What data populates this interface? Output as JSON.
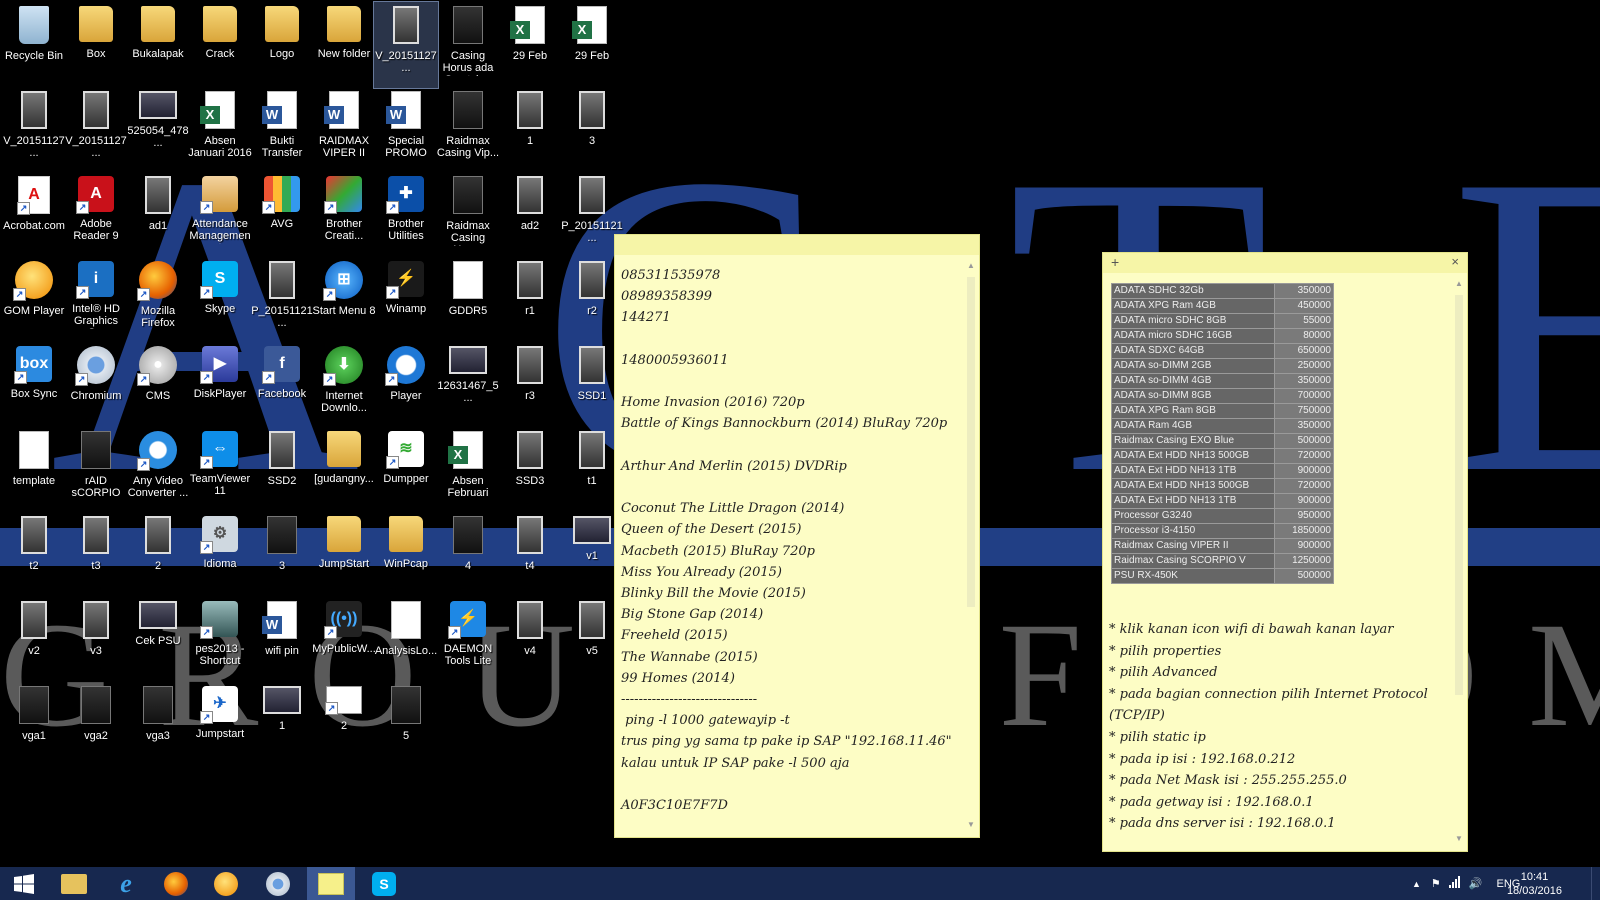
{
  "desktop": {
    "icons": [
      {
        "label": "Recycle Bin",
        "icon": "recycle-bin-icon",
        "type": "recycle"
      },
      {
        "label": "V_20151127...",
        "icon": "video-file-icon",
        "type": "photo"
      },
      {
        "label": "Acrobat.com",
        "icon": "acrobat-icon",
        "type": "acrobat"
      },
      {
        "label": "GOM Player",
        "icon": "gom-player-icon",
        "type": "gom"
      },
      {
        "label": "Box Sync",
        "icon": "box-sync-icon",
        "type": "box"
      },
      {
        "label": "template",
        "icon": "document-icon",
        "type": "doc"
      },
      {
        "label": "t2",
        "icon": "image-icon",
        "type": "photo"
      },
      {
        "label": "v2",
        "icon": "image-icon",
        "type": "photo"
      },
      {
        "label": "vga1",
        "icon": "image-icon",
        "type": "photo-dark"
      },
      {
        "label": "Box",
        "icon": "folder-icon",
        "type": "folder"
      },
      {
        "label": "V_20151127...",
        "icon": "video-file-icon",
        "type": "photo"
      },
      {
        "label": "Adobe Reader 9",
        "icon": "adobe-reader-icon",
        "type": "reader"
      },
      {
        "label": "Intel® HD Graphics C...",
        "icon": "intel-graphics-icon",
        "type": "intel"
      },
      {
        "label": "Chromium",
        "icon": "chromium-icon",
        "type": "chromium"
      },
      {
        "label": "rAID sCORPIO",
        "icon": "image-icon",
        "type": "photo-dark"
      },
      {
        "label": "t3",
        "icon": "image-icon",
        "type": "photo"
      },
      {
        "label": "v3",
        "icon": "image-icon",
        "type": "photo"
      },
      {
        "label": "vga2",
        "icon": "image-icon",
        "type": "photo-dark"
      },
      {
        "label": "Bukalapak",
        "icon": "folder-icon",
        "type": "folder"
      },
      {
        "label": "525054_478...",
        "icon": "image-icon",
        "type": "photo-wide"
      },
      {
        "label": "ad1",
        "icon": "image-icon",
        "type": "photo"
      },
      {
        "label": "Mozilla Firefox",
        "icon": "firefox-icon",
        "type": "firefox"
      },
      {
        "label": "CMS",
        "icon": "cms-icon",
        "type": "cms"
      },
      {
        "label": "Any Video Converter ...",
        "icon": "video-converter-icon",
        "type": "avc"
      },
      {
        "label": "2",
        "icon": "image-icon",
        "type": "photo"
      },
      {
        "label": "Cek PSU",
        "icon": "image-icon",
        "type": "photo-wide"
      },
      {
        "label": "vga3",
        "icon": "image-icon",
        "type": "photo-dark"
      },
      {
        "label": "Crack",
        "icon": "folder-icon",
        "type": "folder"
      },
      {
        "label": "Absen Januari 2016",
        "icon": "excel-file-icon",
        "type": "excel"
      },
      {
        "label": "Attendance Management",
        "icon": "attendance-icon",
        "type": "attendance"
      },
      {
        "label": "Skype",
        "icon": "skype-icon",
        "type": "skype"
      },
      {
        "label": "DiskPlayer",
        "icon": "diskplayer-icon",
        "type": "diskplayer"
      },
      {
        "label": "TeamViewer 11",
        "icon": "teamviewer-icon",
        "type": "teamviewer"
      },
      {
        "label": "Idioma",
        "icon": "idioma-icon",
        "type": "idioma"
      },
      {
        "label": "pes2013 - Shortcut",
        "icon": "pes-icon",
        "type": "pes"
      },
      {
        "label": "Jumpstart",
        "icon": "jumpstart-icon",
        "type": "jumpstart"
      },
      {
        "label": "Logo",
        "icon": "folder-icon",
        "type": "folder"
      },
      {
        "label": "Bukti Transfer",
        "icon": "word-file-icon",
        "type": "word"
      },
      {
        "label": "AVG",
        "icon": "avg-icon",
        "type": "avg"
      },
      {
        "label": "P_20151121...",
        "icon": "image-icon",
        "type": "photo"
      },
      {
        "label": "Facebook",
        "icon": "facebook-icon",
        "type": "facebook"
      },
      {
        "label": "SSD2",
        "icon": "image-icon",
        "type": "photo"
      },
      {
        "label": "3",
        "icon": "image-icon",
        "type": "photo-dark"
      },
      {
        "label": "wifi pin",
        "icon": "word-file-icon",
        "type": "word"
      },
      {
        "label": "1",
        "icon": "image-icon",
        "type": "photo-wide"
      },
      {
        "label": "New folder",
        "icon": "folder-icon",
        "type": "folder"
      },
      {
        "label": "RAIDMAX VIPER II",
        "icon": "word-file-icon",
        "type": "word"
      },
      {
        "label": "Brother Creati...",
        "icon": "brother-creative-icon",
        "type": "brother"
      },
      {
        "label": "Start Menu 8",
        "icon": "start-menu-icon",
        "type": "startmenu"
      },
      {
        "label": "Internet Downlo...",
        "icon": "internet-download-icon",
        "type": "idm"
      },
      {
        "label": "[gudangny...",
        "icon": "folder-icon",
        "type": "folder"
      },
      {
        "label": "JumpStart",
        "icon": "folder-icon",
        "type": "folder"
      },
      {
        "label": "MyPublicW...",
        "icon": "mypublicwifi-icon",
        "type": "mpw"
      },
      {
        "label": "2",
        "icon": "window-icon",
        "type": "window"
      },
      {
        "label": "V_20151127...",
        "icon": "video-file-icon",
        "type": "photo",
        "selected": true
      },
      {
        "label": "Special PROMO",
        "icon": "word-file-icon",
        "type": "word"
      },
      {
        "label": "Brother Utilities",
        "icon": "brother-utilities-icon",
        "type": "brotherutil"
      },
      {
        "label": "Winamp",
        "icon": "winamp-icon",
        "type": "winamp"
      },
      {
        "label": "Player",
        "icon": "media-player-icon",
        "type": "player"
      },
      {
        "label": "Dumpper",
        "icon": "dumpper-icon",
        "type": "dumpper"
      },
      {
        "label": "WinPcap",
        "icon": "folder-icon",
        "type": "folder"
      },
      {
        "label": "AnalysisLo...",
        "icon": "document-icon",
        "type": "doc"
      },
      {
        "label": "5",
        "icon": "image-icon",
        "type": "photo-dark"
      },
      {
        "label": "Casing Horus ada Scratch...",
        "icon": "image-icon",
        "type": "photo-dark"
      },
      {
        "label": "Raidmax Casing Vip...",
        "icon": "image-icon",
        "type": "photo-dark"
      },
      {
        "label": "Raidmax Casing Horus",
        "icon": "image-icon",
        "type": "photo-dark"
      },
      {
        "label": "GDDR5",
        "icon": "document-icon",
        "type": "doc"
      },
      {
        "label": "12631467_5...",
        "icon": "image-icon",
        "type": "photo-wide"
      },
      {
        "label": "Absen Februari",
        "icon": "excel-file-icon",
        "type": "excel"
      },
      {
        "label": "4",
        "icon": "image-icon",
        "type": "photo-dark"
      },
      {
        "label": "DAEMON Tools Lite",
        "icon": "daemon-tools-icon",
        "type": "daemon"
      },
      {
        "label": "29 Feb",
        "icon": "excel-file-icon",
        "type": "excel"
      },
      {
        "label": "1",
        "icon": "image-icon",
        "type": "photo"
      },
      {
        "label": "ad2",
        "icon": "image-icon",
        "type": "photo"
      },
      {
        "label": "r1",
        "icon": "image-icon",
        "type": "photo"
      },
      {
        "label": "r3",
        "icon": "image-icon",
        "type": "photo"
      },
      {
        "label": "SSD3",
        "icon": "image-icon",
        "type": "photo"
      },
      {
        "label": "t4",
        "icon": "image-icon",
        "type": "photo"
      },
      {
        "label": "v4",
        "icon": "image-icon",
        "type": "photo"
      },
      {
        "label": "29 Feb",
        "icon": "excel-file-icon",
        "type": "excel"
      },
      {
        "label": "3",
        "icon": "image-icon",
        "type": "photo"
      },
      {
        "label": "P_20151121...",
        "icon": "image-icon",
        "type": "photo"
      },
      {
        "label": "r2",
        "icon": "image-icon",
        "type": "photo"
      },
      {
        "label": "SSD1",
        "icon": "image-icon",
        "type": "photo"
      },
      {
        "label": "t1",
        "icon": "image-icon",
        "type": "photo"
      },
      {
        "label": "v1",
        "icon": "image-icon",
        "type": "photo-wide"
      },
      {
        "label": "v5",
        "icon": "image-icon",
        "type": "photo"
      }
    ]
  },
  "note1": {
    "text": "085311535978\n08989358399\n144271\n\n1480005936011\n\nHome Invasion (2016) 720p\nBattle of Kings Bannockburn (2014) BluRay 720p\n\nArthur And Merlin (2015) DVDRip\n\nCoconut The Little Dragon (2014)\nQueen of the Desert (2015)\nMacbeth (2015) BluRay 720p\nMiss You Already (2015)\nBlinky Bill the Movie (2015)\nBig Stone Gap (2014)\nFreeheld (2015)\nThe Wannabe (2015)\n99 Homes (2014)\n-------------------------------\n ping -l 1000 gatewayip -t\ntrus ping yg sama tp pake ip SAP \"192.168.11.46\"\nkalau untuk IP SAP pake -l 500 aja\n\nA0F3C10E7F7D"
  },
  "note2": {
    "add_label": "+",
    "close_label": "×",
    "table": [
      {
        "item": "ADATA SDHC 32Gb",
        "price": "350000"
      },
      {
        "item": "ADATA XPG Ram 4GB",
        "price": "450000"
      },
      {
        "item": "ADATA micro SDHC 8GB",
        "price": "55000"
      },
      {
        "item": "ADATA micro SDHC 16GB",
        "price": "80000"
      },
      {
        "item": "ADATA SDXC 64GB",
        "price": "650000"
      },
      {
        "item": "ADATA so-DIMM 2GB",
        "price": "250000"
      },
      {
        "item": "ADATA so-DIMM 4GB",
        "price": "350000"
      },
      {
        "item": "ADATA so-DIMM 8GB",
        "price": "700000"
      },
      {
        "item": "ADATA XPG Ram 8GB",
        "price": "750000"
      },
      {
        "item": "ADATA Ram 4GB",
        "price": "350000"
      },
      {
        "item": "Raidmax Casing EXO Blue",
        "price": "500000"
      },
      {
        "item": "ADATA Ext HDD NH13 500GB",
        "price": "720000"
      },
      {
        "item": "ADATA Ext HDD NH13 1TB",
        "price": "900000"
      },
      {
        "item": "ADATA Ext HDD NH13 500GB",
        "price": "720000"
      },
      {
        "item": "ADATA Ext HDD NH13 1TB",
        "price": "900000"
      },
      {
        "item": "Processor G3240",
        "price": "950000"
      },
      {
        "item": "Processor i3-4150",
        "price": "1850000"
      },
      {
        "item": "Raidmax Casing VIPER II",
        "price": "900000"
      },
      {
        "item": "Raidmax Casing SCORPIO V",
        "price": "1250000"
      },
      {
        "item": "PSU RX-450K",
        "price": "500000"
      }
    ],
    "text": "* klik kanan icon wifi di bawah kanan layar\n* pilih properties\n* pilih Advanced\n* pada bagian connection pilih Internet Protocol\n(TCP/IP)\n* pilih static ip\n* pada ip isi : 192.168.0.212\n* pada Net Mask isi : 255.255.255.0\n* pada getway isi : 192.168.0.1\n* pada dns server isi : 192.168.0.1"
  },
  "taskbar": {
    "apps": [
      {
        "name": "start-button",
        "icon": "windows-logo-icon"
      },
      {
        "name": "file-explorer",
        "icon": "file-explorer-icon"
      },
      {
        "name": "internet-explorer",
        "icon": "internet-explorer-icon"
      },
      {
        "name": "firefox",
        "icon": "firefox-icon"
      },
      {
        "name": "gom-player",
        "icon": "gom-player-icon"
      },
      {
        "name": "chromium",
        "icon": "chromium-icon"
      },
      {
        "name": "sticky-notes",
        "icon": "sticky-notes-icon",
        "active": true
      },
      {
        "name": "skype",
        "icon": "skype-icon"
      }
    ],
    "language": "ENG",
    "time": "10:41",
    "date": "18/03/2016"
  },
  "wallpaper": {
    "logo_text": "ACTETA",
    "group_text": "GROUP OF COMPANIES",
    "colors": {
      "blue": "#203d84",
      "gray": "#5a5a5a"
    }
  }
}
